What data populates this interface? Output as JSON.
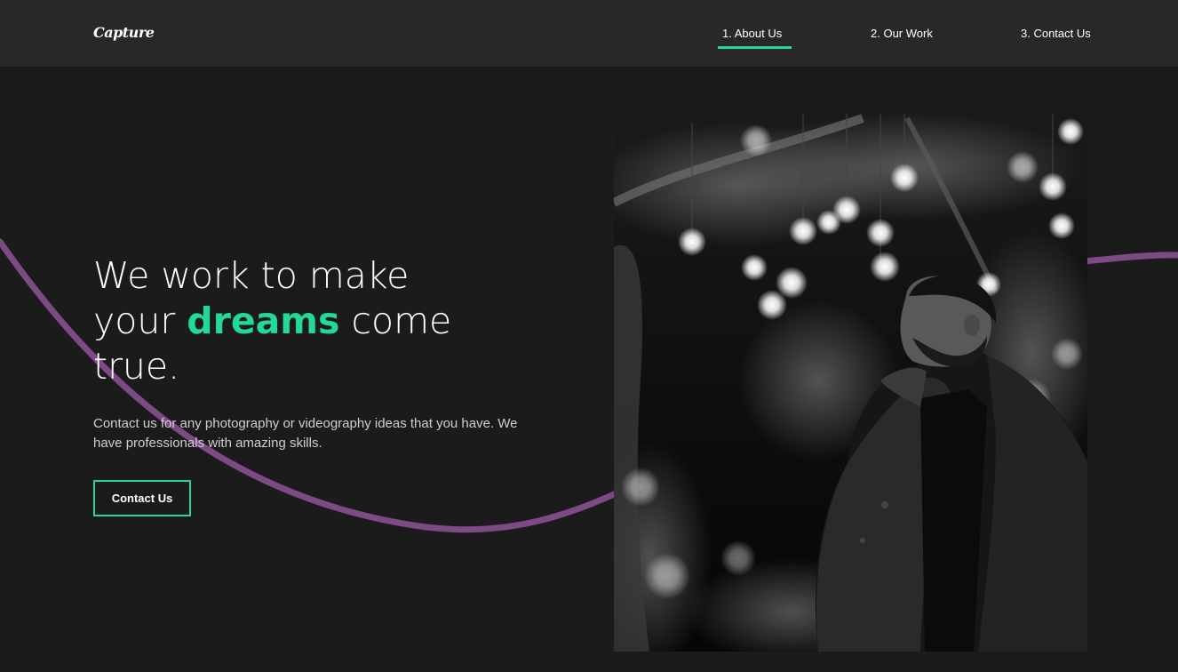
{
  "header": {
    "logo": "Capture",
    "nav": [
      {
        "label": "1. About Us",
        "active": true
      },
      {
        "label": "2. Our Work",
        "active": false
      },
      {
        "label": "3. Contact Us",
        "active": false
      }
    ]
  },
  "hero": {
    "headline_part1": "We work to make your",
    "headline_highlight": "dreams",
    "headline_part2": "come true.",
    "description": "Contact us for any photography or videography ideas that you have. We have professionals with amazing skills.",
    "cta_label": "Contact Us",
    "photo_alt": "Man in jacket standing under string lights at night"
  },
  "colors": {
    "background": "#1b1b1b",
    "header": "#282828",
    "accent": "#23d997",
    "wave": "#7d4a86"
  }
}
